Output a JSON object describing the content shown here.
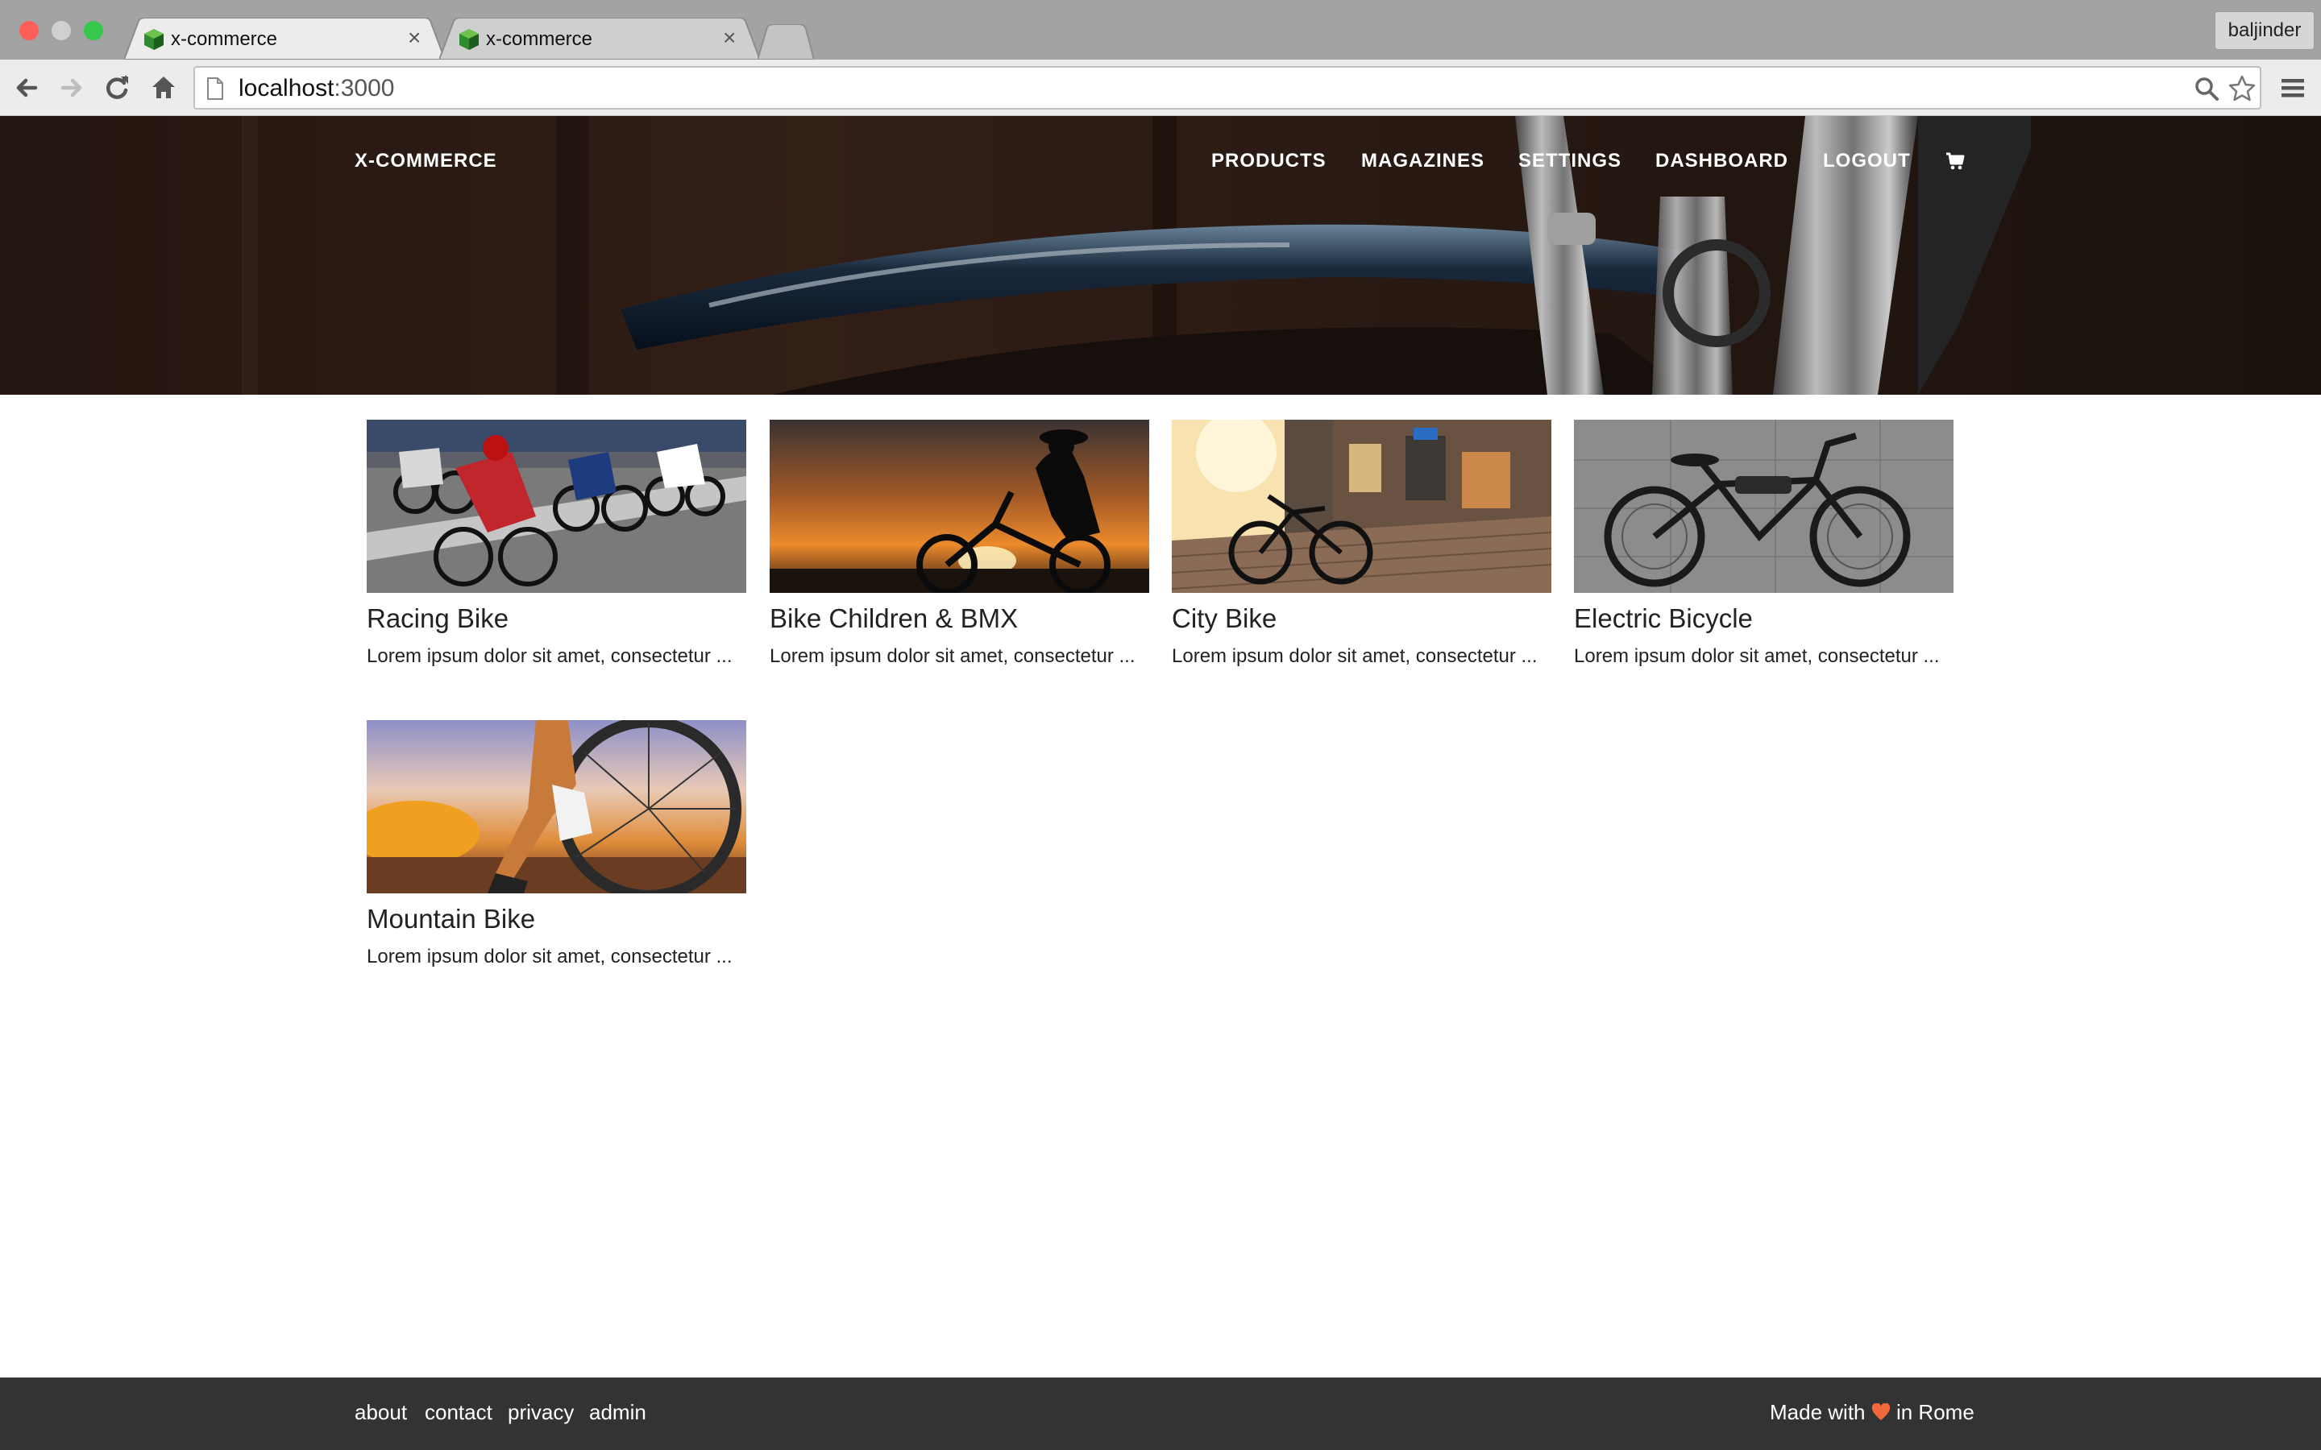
{
  "browser": {
    "tabs": [
      {
        "title": "x-commerce",
        "close": "×"
      },
      {
        "title": "x-commerce",
        "close": "×"
      }
    ],
    "user": "baljinder",
    "url_host": "localhost",
    "url_port": ":3000"
  },
  "site": {
    "brand": "X-COMMERCE",
    "nav": [
      "PRODUCTS",
      "MAGAZINES",
      "SETTINGS",
      "DASHBOARD",
      "LOGOUT"
    ],
    "cart_icon": "cart-icon"
  },
  "products": [
    {
      "name": "Racing Bike",
      "desc": "Lorem ipsum dolor sit amet, consectetur ..."
    },
    {
      "name": "Bike Children & BMX",
      "desc": "Lorem ipsum dolor sit amet, consectetur ..."
    },
    {
      "name": "City Bike",
      "desc": "Lorem ipsum dolor sit amet, consectetur ..."
    },
    {
      "name": "Electric Bicycle",
      "desc": "Lorem ipsum dolor sit amet, consectetur ..."
    },
    {
      "name": "Mountain Bike",
      "desc": "Lorem ipsum dolor sit amet, consectetur ..."
    }
  ],
  "footer": {
    "links": [
      "about",
      "contact",
      "privacy",
      "admin"
    ],
    "made_prefix": "Made with",
    "made_suffix": "in Rome"
  },
  "colors": {
    "heart": "#f0683c",
    "footer_bg": "#333333"
  }
}
